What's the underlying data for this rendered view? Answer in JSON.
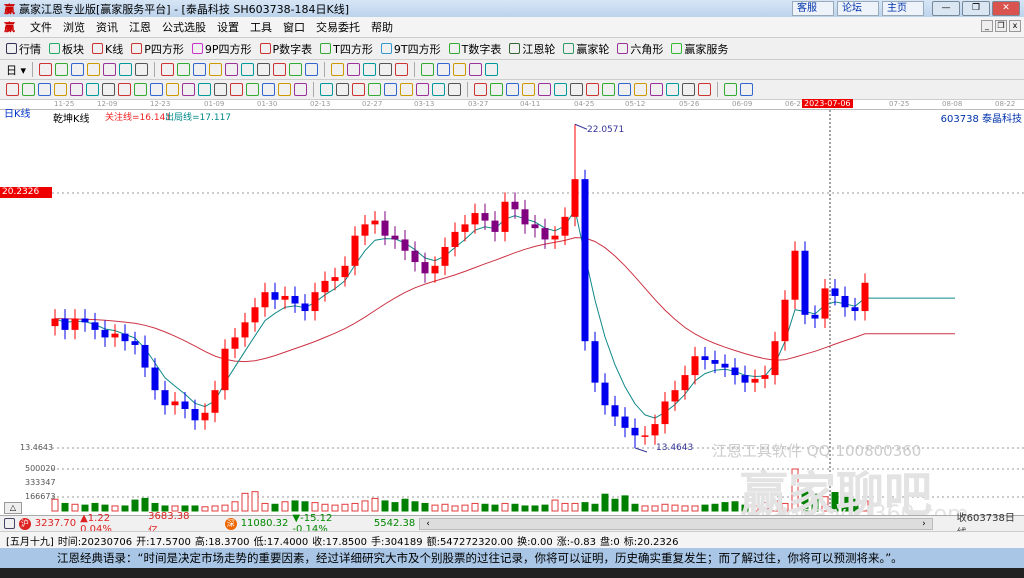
{
  "window": {
    "title": "赢家江恩专业版[赢家服务平台] - [泰晶科技  SH603738-184日K线]",
    "links": [
      "客服",
      "论坛",
      "主页"
    ],
    "logo": "赢"
  },
  "menu": [
    "文件",
    "浏览",
    "资讯",
    "江恩",
    "公式选股",
    "设置",
    "工具",
    "窗口",
    "交易委托",
    "帮助"
  ],
  "toolbar1": [
    {
      "label": "行情",
      "icon": "quote-board-icon",
      "color": "#335"
    },
    {
      "label": "板块",
      "icon": "sector-icon",
      "color": "#2a6"
    },
    {
      "label": "K线",
      "icon": "kline-icon",
      "color": "#c33"
    },
    {
      "label": "P四方形",
      "icon": "p-square-icon",
      "color": "#c33"
    },
    {
      "label": "9P四方形",
      "icon": "9p-square-icon",
      "color": "#c3c"
    },
    {
      "label": "P数字表",
      "icon": "p-number-table-icon",
      "color": "#c33"
    },
    {
      "label": "T四方形",
      "icon": "t-square-icon",
      "color": "#3a3"
    },
    {
      "label": "9T四方形",
      "icon": "9t-square-icon",
      "color": "#39c"
    },
    {
      "label": "T数字表",
      "icon": "t-number-table-icon",
      "color": "#3a3"
    },
    {
      "label": "江恩轮",
      "icon": "gann-wheel-icon",
      "color": "#363"
    },
    {
      "label": "赢家轮",
      "icon": "winner-wheel-icon",
      "color": "#396"
    },
    {
      "label": "六角形",
      "icon": "hexagon-icon",
      "color": "#939"
    },
    {
      "label": "赢家服务",
      "icon": "dollar-icon",
      "color": "#3b3"
    }
  ],
  "toolbar2": {
    "period": "日",
    "icons": [
      "cycle-icon",
      "calendar-icon",
      "bars-icon",
      "bars2-icon",
      "candle-icon",
      "weight-icon",
      "flag-icon",
      "first-icon",
      "last-icon",
      "prev-icon",
      "next-icon",
      "zoom-in-icon",
      "zoom-out-icon",
      "shift-left-icon",
      "shift-right-icon",
      "expand-icon",
      "shrink-icon",
      "hand-icon",
      "crosshair-icon",
      "line-icon",
      "node-icon",
      "tree-icon",
      "calc-icon",
      "save-icon",
      "print-icon",
      "disk-icon",
      "network-icon"
    ]
  },
  "toolbar3": {
    "icons": [
      "pen-icon",
      "grid-icon",
      "gold1-icon",
      "gold2-icon",
      "fan-icon",
      "arc-icon",
      "speed-icon",
      "circle-icon",
      "parallel-icon",
      "n2-icon",
      "angle-icon",
      "target-icon",
      "star-icon",
      "box-icon",
      "wave-icon",
      "split-icon",
      "cube-icon",
      "matrix-icon",
      "gann-icon",
      "rect-icon",
      "ray-icon",
      "square-icon",
      "square2-icon",
      "angle2-icon",
      "zigzag-icon",
      "table-icon",
      "table2-icon",
      "lines-icon",
      "text-icon",
      "percent-fan-icon",
      "percent-icon",
      "level-icon",
      "coin-icon",
      "gold-level-icon",
      "flag2-icon",
      "ab-icon",
      "gold3-icon",
      "line1-icon",
      "f-line-icon",
      "line2-icon",
      "line3-icon",
      "line4-icon",
      "line5-icon",
      "yinyang-icon",
      "infinity-icon"
    ]
  },
  "date_axis": {
    "labels": [
      "11-25",
      "12-09",
      "12-23",
      "01-09",
      "01-30",
      "02-13",
      "02-27",
      "03-13",
      "03-27",
      "04-11",
      "04-25",
      "05-12",
      "05-26",
      "06-09",
      "06-27",
      "2023-07-06",
      "07-25",
      "08-08",
      "08-22"
    ]
  },
  "chart_header": {
    "period": "日K线",
    "indicator": "乾坤K线",
    "focus_line": "关注线=16.141",
    "exit_line": "出局线=17.117",
    "stock": "603738  泰晶科技",
    "cursor_price": "20.2326",
    "high_label": "22.0571",
    "low_label": "13.4643",
    "low_axis": "13.4643",
    "vol_ticks": [
      "500020",
      "333347",
      "166673"
    ],
    "watermark1": "江恩工具软件  QQ:100800360",
    "watermark2": "赢家聊吧",
    "watermark3": "liaoba.yicf360.com"
  },
  "chart_data": {
    "type": "candlestick",
    "closes": [
      16.9,
      16.6,
      16.9,
      16.8,
      16.6,
      16.4,
      16.5,
      16.3,
      16.2,
      15.6,
      15.0,
      14.6,
      14.7,
      14.5,
      14.2,
      14.4,
      15.0,
      16.1,
      16.4,
      16.8,
      17.2,
      17.6,
      17.4,
      17.5,
      17.3,
      17.1,
      17.6,
      17.9,
      18.0,
      18.3,
      19.1,
      19.4,
      19.5,
      19.1,
      19.0,
      18.7,
      18.4,
      18.1,
      18.3,
      18.8,
      19.2,
      19.4,
      19.7,
      19.5,
      19.2,
      20.0,
      19.8,
      19.4,
      19.3,
      19.0,
      19.1,
      19.6,
      20.6,
      16.3,
      15.2,
      14.6,
      14.3,
      14.0,
      13.8,
      13.8,
      14.1,
      14.7,
      15.0,
      15.4,
      15.9,
      15.8,
      15.7,
      15.6,
      15.4,
      15.2,
      15.3,
      15.4,
      16.3,
      17.4,
      18.7,
      17.0,
      16.9,
      17.7,
      17.5,
      17.2,
      17.1,
      17.85
    ],
    "volumes": [
      140000,
      90000,
      80000,
      70000,
      90000,
      70000,
      60000,
      60000,
      130000,
      150000,
      90000,
      60000,
      60000,
      60000,
      60000,
      50000,
      60000,
      70000,
      110000,
      210000,
      230000,
      90000,
      80000,
      110000,
      120000,
      110000,
      100000,
      80000,
      70000,
      80000,
      90000,
      120000,
      150000,
      120000,
      100000,
      140000,
      110000,
      90000,
      70000,
      80000,
      60000,
      70000,
      90000,
      80000,
      70000,
      90000,
      80000,
      60000,
      60000,
      70000,
      130000,
      90000,
      90000,
      100000,
      80000,
      200000,
      140000,
      180000,
      80000,
      60000,
      60000,
      80000,
      70000,
      60000,
      60000,
      70000,
      80000,
      100000,
      110000,
      70000,
      60000,
      100000,
      120000,
      90000,
      500000,
      230000,
      200000,
      170000,
      220000,
      180000,
      140000,
      120000
    ],
    "price_range": [
      13.4643,
      22.0571
    ],
    "high": 22.0571,
    "low": 13.4643
  },
  "index_bar": {
    "sh_value": "3237.70",
    "sh_change": "▲1.22 0.04%",
    "sh_amount": "3683.38亿",
    "sz_value": "11080.32",
    "sz_change": "▼-15.12 -0.14%",
    "sz_amount": "5542.38",
    "sh_icon": "沪",
    "sz_icon": "深",
    "right": "收603738日线"
  },
  "status": {
    "lunar": "[五月十九]",
    "time": "时间:20230706",
    "open": "开:17.5700",
    "high": "高:18.3700",
    "low": "低:17.4000",
    "close": "收:17.8500",
    "hands": "手:304189",
    "amount": "额:547272320.00",
    "turnover": "换:0.00",
    "change": "涨:-0.83",
    "pan": "盘:0",
    "mark": "标:20.2326"
  },
  "quote": "江恩经典语录：“时间是决定市场走势的重要因素，经过详细研究大市及个别股票的过往记录，你将可以证明，历史确实重复发生；而了解过往，你将可以预测将来。”。",
  "colors": {
    "up": "#ff0000",
    "down": "#0000ee",
    "down_high": "#800080",
    "ma_short": "#118888",
    "ma_long": "#cc3344",
    "vol_up": "#e23b3b",
    "vol_down": "#008000"
  }
}
